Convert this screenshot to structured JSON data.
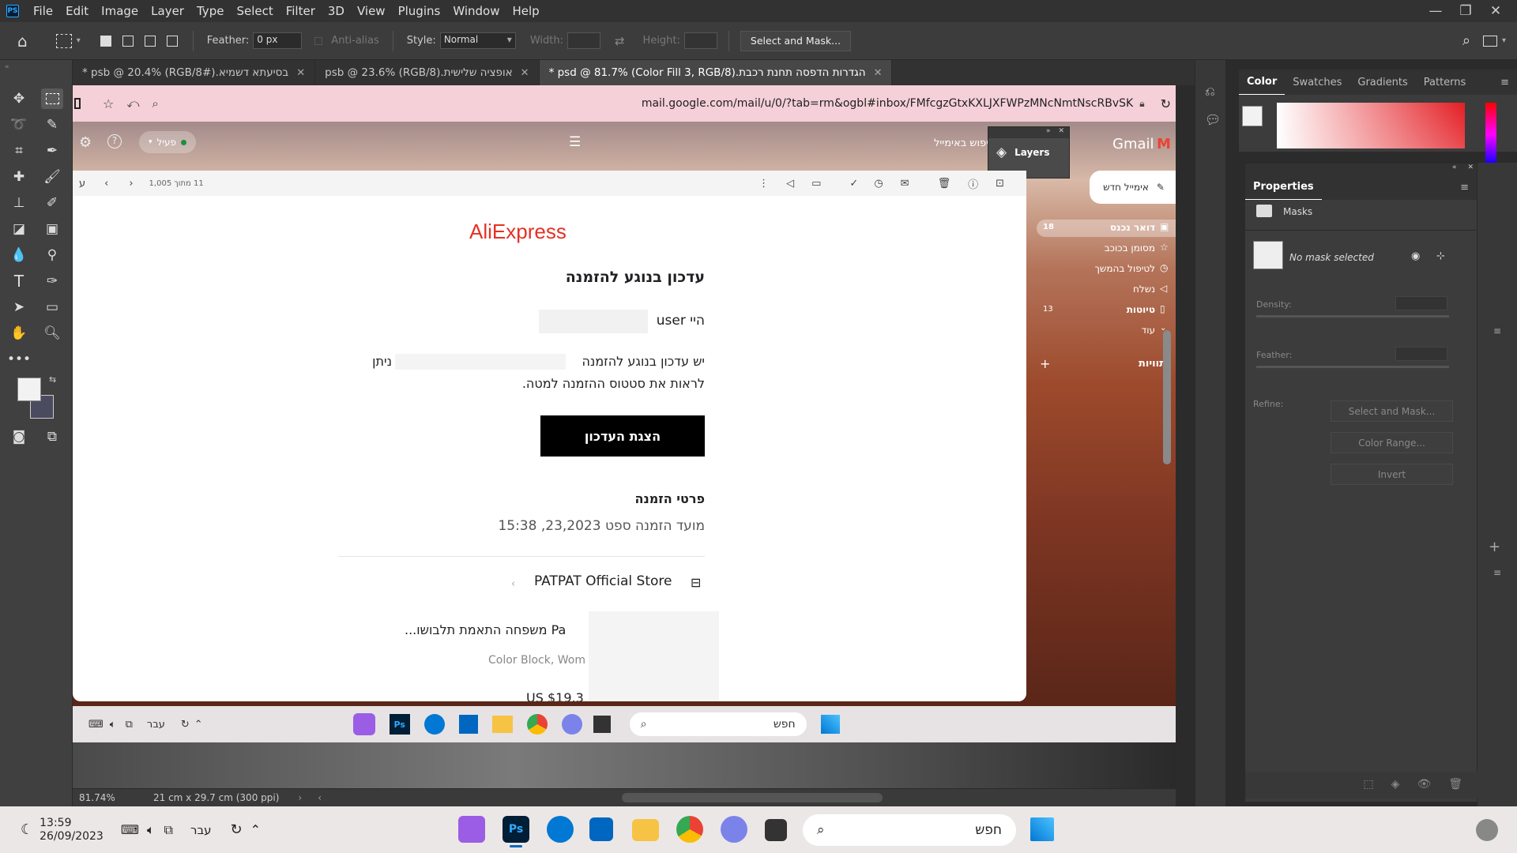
{
  "menubar": {
    "app_icon": "PS",
    "items": [
      "File",
      "Edit",
      "Image",
      "Layer",
      "Type",
      "Select",
      "Filter",
      "3D",
      "View",
      "Plugins",
      "Window",
      "Help"
    ],
    "window_controls": [
      "—",
      "❐",
      "✕"
    ]
  },
  "options": {
    "feather_label": "Feather:",
    "feather_value": "0 px",
    "antialias_label": "Anti-alias",
    "style_label": "Style:",
    "style_value": "Normal",
    "width_label": "Width:",
    "height_label": "Height:",
    "select_mask_label": "Select and Mask..."
  },
  "tabs": [
    {
      "label": "בסיעתא דשמיא.psb @ 20.4% (RGB/8#) *"
    },
    {
      "label": "אופציה שלישית.psb @ 23.6% (RGB/8)"
    },
    {
      "label": "הגדרות הדפסה תחנת רכבת.psd @ 81.7% (Color Fill 3, RGB/8) *"
    }
  ],
  "browser": {
    "url": "mail.google.com/mail/u/0/?tab=rm&ogbl#inbox/FMfcgzGtxKXLJXFWPzMNcNmtNscRBvSK"
  },
  "gmail": {
    "logo_text": "Gmail",
    "search_hint": "חיפוש באימייל",
    "status_label": "פעיל",
    "compose_label": "אימייל חדש",
    "pager": "11 מתוך 1,005",
    "nav": [
      {
        "label": "דואר נכנס",
        "count": "18"
      },
      {
        "label": "מסומן בכוכב",
        "count": ""
      },
      {
        "label": "לטיפול בהמשך",
        "count": ""
      },
      {
        "label": "נשלח",
        "count": ""
      },
      {
        "label": "טיוטות",
        "count": "13"
      },
      {
        "label": "עוד",
        "count": ""
      }
    ],
    "labels_header": "תוויות"
  },
  "layers_panel": {
    "label": "Layers"
  },
  "email": {
    "brand": "AliExpress",
    "heading": "עדכון בנוגע להזמנה",
    "greeting": "היי user",
    "body_line1": "יש עדכון בנוגע להזמנה",
    "body_line1b": "ניתן",
    "body_line2": "לראות את סטטוס ההזמנה למטה.",
    "cta": "הצגת העדכון",
    "details_header": "פרטי הזמנה",
    "order_date": "מועד הזמנה ספט 23,2023, 15:38",
    "store": "PATPAT Official Store",
    "product_title": "Pa משפחה התאמת תלבושו...",
    "product_variant": "Color Block, Wom",
    "price": "US $19.3"
  },
  "inner_taskbar": {
    "search": "חפש",
    "lang": "עבר"
  },
  "statusbar": {
    "zoom": "81.74%",
    "doc_size": "21 cm x 29.7 cm (300 ppi)"
  },
  "color_panel": {
    "tabs": [
      "Color",
      "Swatches",
      "Gradients",
      "Patterns"
    ],
    "accent": "#e31e24"
  },
  "properties": {
    "title": "Properties",
    "masks_label": "Masks",
    "no_mask": "No mask selected",
    "density_label": "Density:",
    "feather_label": "Feather:",
    "refine_label": "Refine:",
    "select_mask_btn": "Select and Mask...",
    "color_range_btn": "Color Range...",
    "invert_btn": "Invert"
  },
  "taskbar": {
    "time": "13:59",
    "date": "26/09/2023",
    "lang": "עבר",
    "search": "חפש"
  }
}
